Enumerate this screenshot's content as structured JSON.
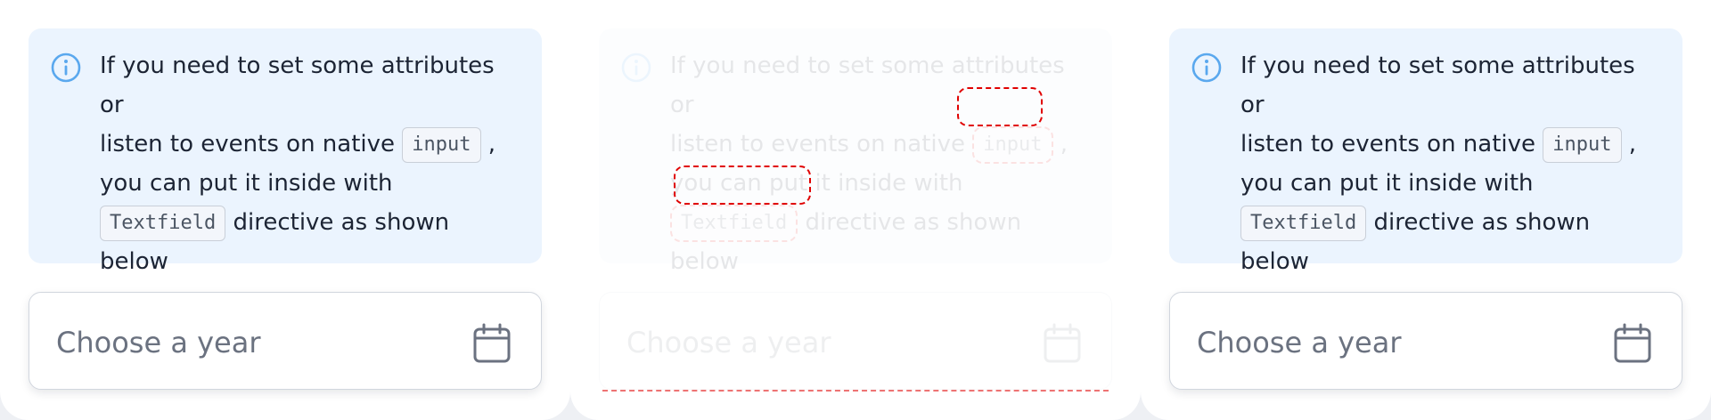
{
  "callout": {
    "line1": "If you need to set some attributes or",
    "line2_pre": "listen to events on native",
    "code_input": "input",
    "line2_post": ",",
    "line3": "you can put it inside with",
    "code_textfield": "Textfield",
    "line4_post": "directive as shown",
    "line5": "below"
  },
  "field": {
    "placeholder": "Choose a year"
  },
  "icons": {
    "info": "info-circle-icon",
    "calendar": "calendar-icon"
  },
  "colors": {
    "callout_bg": "#ebf4fe",
    "info_icon": "#5aa8ee",
    "text": "#1c2434",
    "placeholder": "#6b7280",
    "error_outline": "#e00000"
  }
}
